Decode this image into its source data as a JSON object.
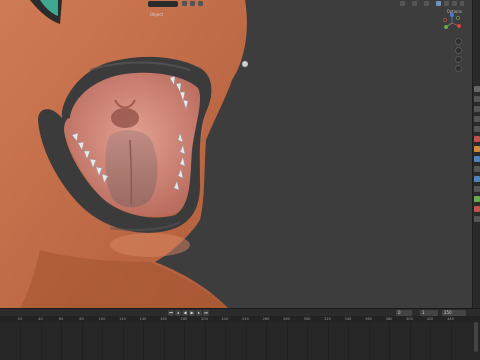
{
  "viewport": {
    "header": {
      "mode_label": "Object",
      "options_label": "Options"
    },
    "gizmo": {
      "x_label": "X",
      "y_label": "Y",
      "z_label": "Z"
    }
  },
  "timeline": {
    "start_frame": "1",
    "end_frame": "250",
    "current_frame": "0",
    "ruler_ticks": [
      "20",
      "40",
      "60",
      "80",
      "100",
      "120",
      "140",
      "160",
      "180",
      "200",
      "220",
      "240",
      "260",
      "280",
      "300",
      "320",
      "340",
      "360",
      "380",
      "400",
      "420",
      "440"
    ]
  },
  "colors": {
    "skin": "#c66f4a",
    "lip": "#3b3b3b",
    "mouth_inner": "#d8897a",
    "tongue": "#b07a70",
    "teeth": "#e6e6e6",
    "background": "#3d3d3d"
  }
}
